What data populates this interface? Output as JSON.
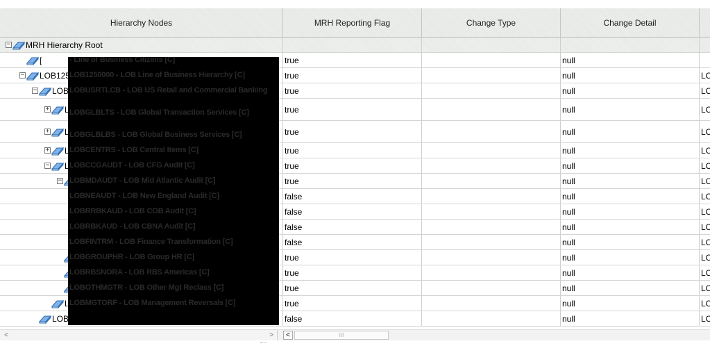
{
  "columns": [
    "Hierarchy Nodes",
    "MRH Reporting Flag",
    "Change Type",
    "Change Detail",
    ""
  ],
  "root_label": "MRH Hierarchy Root",
  "rows": [
    {
      "toggle": "",
      "label": "[",
      "flag": "true",
      "change_type": "",
      "detail": "null",
      "extra": ""
    },
    {
      "toggle": "⊟",
      "label": "LOB125001",
      "flag": "true",
      "change_type": "",
      "detail": "null",
      "extra": "LC"
    },
    {
      "toggle": "⊟",
      "label": "LOB1",
      "flag": "true",
      "change_type": "",
      "detail": "null",
      "extra": "LC"
    },
    {
      "toggle": "⊞",
      "label": "LOBUSRTL",
      "flag": "true",
      "change_type": "",
      "detail": "null",
      "extra": "LC"
    },
    {
      "toggle": "⊞",
      "label": "LOBGL",
      "flag": "true",
      "change_type": "",
      "detail": "null",
      "extra": "LC"
    },
    {
      "toggle": "⊞",
      "label": "LOBGL",
      "flag": "true",
      "change_type": "",
      "detail": "null",
      "extra": "LC"
    },
    {
      "toggle": "⊟",
      "label": "LOBCE",
      "flag": "true",
      "change_type": "",
      "detail": "null",
      "extra": "LC"
    },
    {
      "toggle": "⊟",
      "label": "LOB",
      "flag": "true",
      "change_type": "",
      "detail": "null",
      "extra": "LC"
    },
    {
      "toggle": "",
      "label": "",
      "flag": "false",
      "change_type": "",
      "detail": "null",
      "extra": "LC"
    },
    {
      "toggle": "",
      "label": "",
      "flag": "false",
      "change_type": "",
      "detail": "null",
      "extra": "LC"
    },
    {
      "toggle": "",
      "label": "",
      "flag": "false",
      "change_type": "",
      "detail": "null",
      "extra": "LC"
    },
    {
      "toggle": "",
      "label": "",
      "flag": "false",
      "change_type": "",
      "detail": "null",
      "extra": "LC"
    },
    {
      "toggle": "",
      "label": "",
      "flag": "true",
      "change_type": "",
      "detail": "null",
      "extra": "LC"
    },
    {
      "toggle": "",
      "label": "",
      "flag": "true",
      "change_type": "",
      "detail": "null",
      "extra": "LC"
    },
    {
      "toggle": "",
      "label": "",
      "flag": "true",
      "change_type": "",
      "detail": "null",
      "extra": "LC"
    },
    {
      "toggle": "",
      "label": "LOB",
      "flag": "true",
      "change_type": "",
      "detail": "null",
      "extra": "LC"
    },
    {
      "toggle": "",
      "label": "LOBM",
      "flag": "false",
      "change_type": "",
      "detail": "null",
      "extra": "LC"
    }
  ],
  "redacted_labels": [
    "- Line of Business Citizens [C]",
    "LOB1250000 - LOB Line of Business Hierarchy [C]",
    "LOBUSRTLCB - LOB US Retail and Commercial Banking",
    "LOBGLBLTS - LOB Global Transaction Services [C]",
    "LOBGLBLBS - LOB Global Business Services [C]",
    "LOBCENTRS - LOB Central Items [C]",
    "LOBCCGAUDT - LOB CFG Audit [C]",
    "LOBMDAUDT - LOB Mid Atlantic Audit [C]",
    "LOBNEAUDT - LOB New England Audit [C]",
    "LOBRRBKAUD - LOB COB Audit [C]",
    "LOBRBKAUD - LOB CBNA Audit [C]",
    "LOBFINTRM - LOB Finance Transformation [C]",
    "LOBGROUPHR - LOB Group HR [C]",
    "LOBRBSNORA - LOB RBS Americas [C]",
    "LOBOTHMGTR - LOB Other Mgt Reclass [C]",
    "LOBMGTORF - LOB Management Reversals [C]"
  ],
  "scroll": {
    "left_arrow": "<",
    "right_arrow": ">",
    "thumb_grip": "III"
  }
}
